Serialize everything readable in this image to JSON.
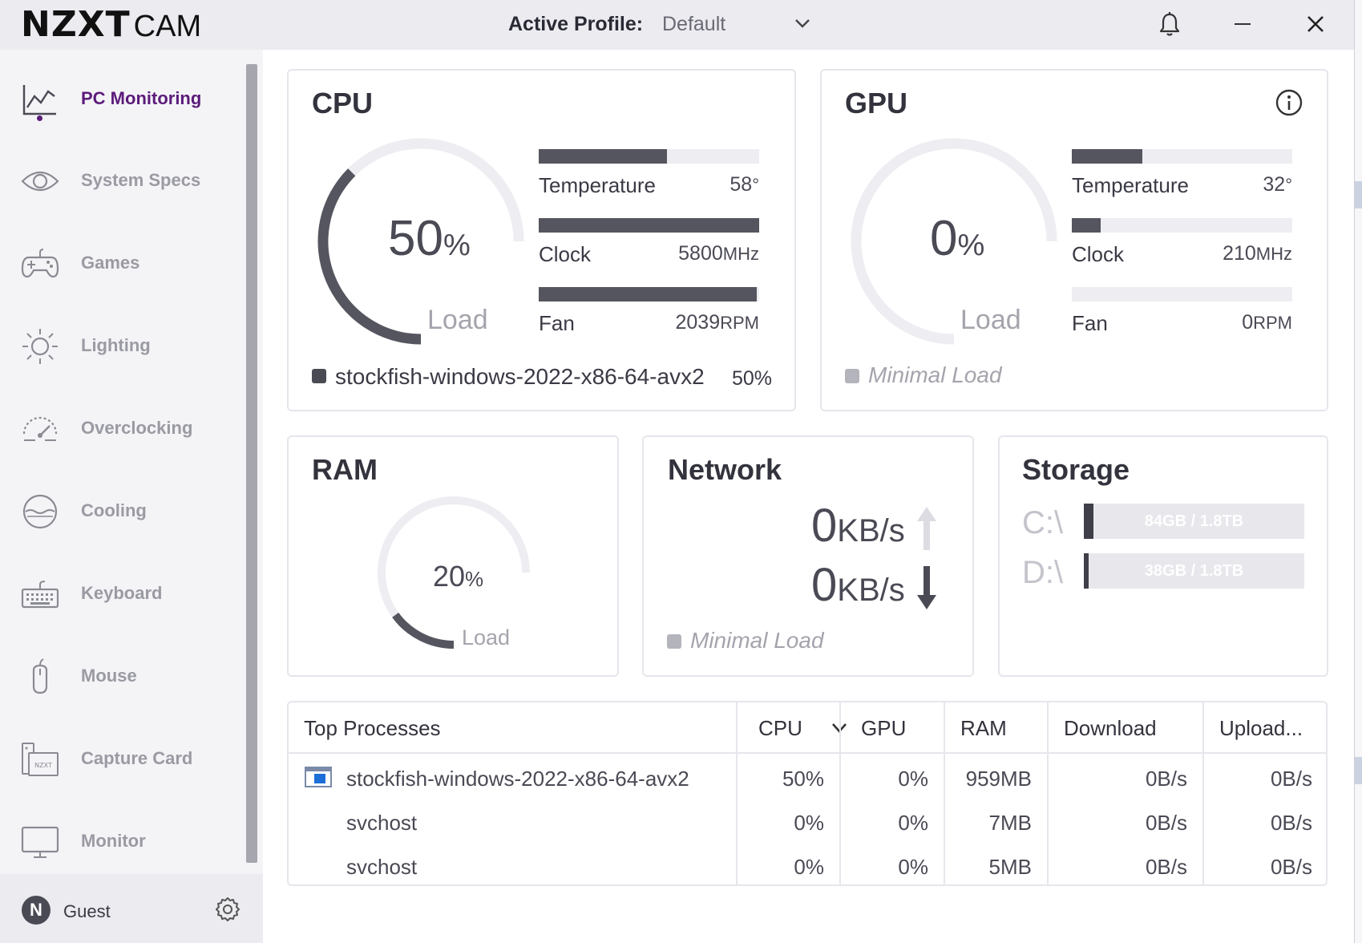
{
  "app": {
    "brand": "NZXT",
    "product": "CAM"
  },
  "header": {
    "profile_label": "Active Profile:",
    "profile_value": "Default"
  },
  "sidebar": {
    "items": [
      {
        "label": "PC Monitoring",
        "icon": "chart-line-icon",
        "active": true
      },
      {
        "label": "System Specs",
        "icon": "eye-icon"
      },
      {
        "label": "Games",
        "icon": "gamepad-icon"
      },
      {
        "label": "Lighting",
        "icon": "sun-icon"
      },
      {
        "label": "Overclocking",
        "icon": "speedometer-icon"
      },
      {
        "label": "Cooling",
        "icon": "water-icon"
      },
      {
        "label": "Keyboard",
        "icon": "keyboard-icon"
      },
      {
        "label": "Mouse",
        "icon": "mouse-icon"
      },
      {
        "label": "Capture Card",
        "icon": "capture-card-icon"
      },
      {
        "label": "Monitor",
        "icon": "monitor-icon"
      }
    ],
    "user": {
      "initial": "N",
      "name": "Guest"
    }
  },
  "cpu": {
    "title": "CPU",
    "load_value": "50",
    "load_unit": "%",
    "load_fraction": 0.5,
    "load_label": "Load",
    "temperature": {
      "label": "Temperature",
      "value": "58",
      "unit": "°",
      "fraction": 0.58
    },
    "clock": {
      "label": "Clock",
      "value": "5800",
      "unit": "MHz",
      "fraction": 1.0
    },
    "fan": {
      "label": "Fan",
      "value": "2039",
      "unit": "RPM",
      "fraction": 0.99
    },
    "top_process": {
      "name": "stockfish-windows-2022-x86-64-avx2",
      "value": "50%"
    }
  },
  "gpu": {
    "title": "GPU",
    "load_value": "0",
    "load_unit": "%",
    "load_fraction": 0.0,
    "load_label": "Load",
    "temperature": {
      "label": "Temperature",
      "value": "32",
      "unit": "°",
      "fraction": 0.32
    },
    "clock": {
      "label": "Clock",
      "value": "210",
      "unit": "MHz",
      "fraction": 0.13
    },
    "fan": {
      "label": "Fan",
      "value": "0",
      "unit": "RPM",
      "fraction": 0.0
    },
    "status": "Minimal Load"
  },
  "ram": {
    "title": "RAM",
    "load_value": "20",
    "load_unit": "%",
    "load_fraction": 0.2,
    "load_label": "Load"
  },
  "network": {
    "title": "Network",
    "upload_value": "0",
    "upload_unit": "KB/s",
    "download_value": "0",
    "download_unit": "KB/s",
    "status": "Minimal Load"
  },
  "storage": {
    "title": "Storage",
    "drives": [
      {
        "label": "C:\\",
        "usage": "84GB / 1.8TB",
        "fraction": 0.045
      },
      {
        "label": "D:\\",
        "usage": "38GB / 1.8TB",
        "fraction": 0.02
      }
    ]
  },
  "processes": {
    "columns": [
      "Top Processes",
      "CPU",
      "GPU",
      "RAM",
      "Download",
      "Upload..."
    ],
    "rows": [
      {
        "name": "stockfish-windows-2022-x86-64-avx2",
        "cpu": "50%",
        "gpu": "0%",
        "ram": "959MB",
        "download": "0B/s",
        "upload": "0B/s",
        "has_icon": true
      },
      {
        "name": "svchost",
        "cpu": "0%",
        "gpu": "0%",
        "ram": "7MB",
        "download": "0B/s",
        "upload": "0B/s"
      },
      {
        "name": "svchost",
        "cpu": "0%",
        "gpu": "0%",
        "ram": "5MB",
        "download": "0B/s",
        "upload": "0B/s"
      }
    ]
  },
  "colors": {
    "accent": "#5c1b7a",
    "bar_fill": "#55555f",
    "bar_track": "#ededf2",
    "muted": "#a4a4ad"
  }
}
